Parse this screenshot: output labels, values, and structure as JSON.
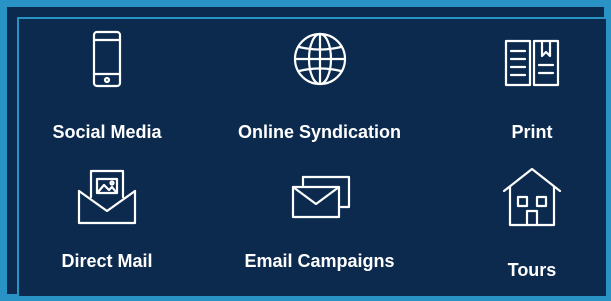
{
  "services": [
    {
      "label": "Social Media",
      "icon": "smartphone-icon"
    },
    {
      "label": "Online Syndication",
      "icon": "globe-icon"
    },
    {
      "label": "Print",
      "icon": "open-book-icon"
    },
    {
      "label": "Direct Mail",
      "icon": "envelope-with-photo-icon"
    },
    {
      "label": "Email Campaigns",
      "icon": "stacked-envelopes-icon"
    },
    {
      "label": "Tours",
      "icon": "house-icon"
    }
  ],
  "colors": {
    "background": "#0b2a4e",
    "border": "#2a93c6",
    "foreground": "#ffffff"
  }
}
